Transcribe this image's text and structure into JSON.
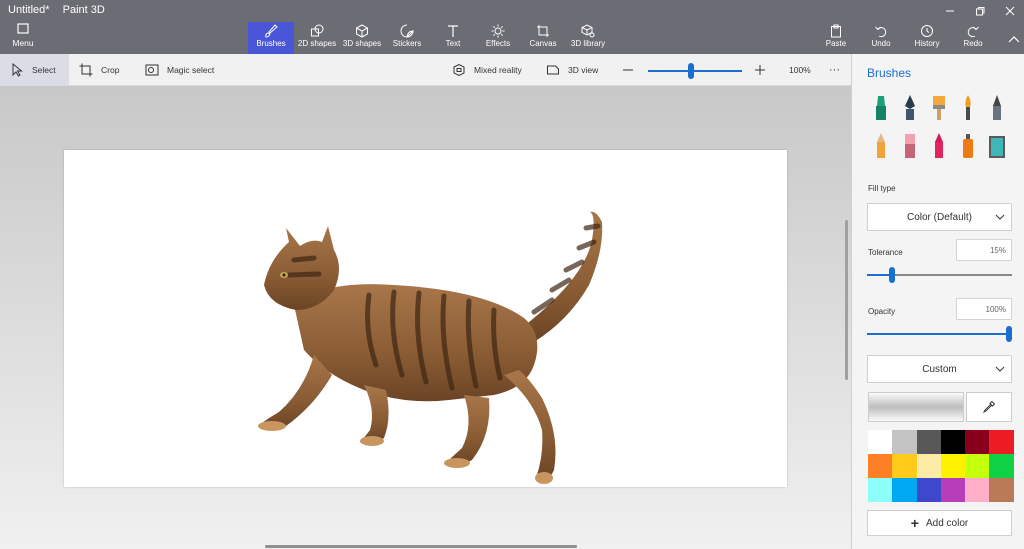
{
  "titlebar": {
    "document": "Untitled*",
    "app": "Paint 3D"
  },
  "menu": {
    "label": "Menu",
    "icon": "menu-icon"
  },
  "tabs": [
    {
      "id": "brushes",
      "label": "Brushes",
      "icon": "brush-icon",
      "active": true
    },
    {
      "id": "2d-shapes",
      "label": "2D shapes",
      "icon": "2d-shapes-icon"
    },
    {
      "id": "3d-shapes",
      "label": "3D shapes",
      "icon": "cube-icon"
    },
    {
      "id": "stickers",
      "label": "Stickers",
      "icon": "sticker-icon"
    },
    {
      "id": "text",
      "label": "Text",
      "icon": "text-icon"
    },
    {
      "id": "effects",
      "label": "Effects",
      "icon": "sun-icon"
    },
    {
      "id": "canvas",
      "label": "Canvas",
      "icon": "canvas-icon"
    },
    {
      "id": "3d-library",
      "label": "3D library",
      "icon": "library-icon"
    }
  ],
  "actions": [
    {
      "id": "paste",
      "label": "Paste",
      "icon": "paste-icon"
    },
    {
      "id": "undo",
      "label": "Undo",
      "icon": "undo-icon"
    },
    {
      "id": "history",
      "label": "History",
      "icon": "history-icon"
    },
    {
      "id": "redo",
      "label": "Redo",
      "icon": "redo-icon"
    }
  ],
  "subtoolbar": {
    "select": "Select",
    "crop": "Crop",
    "magic_select": "Magic select",
    "mixed_reality": "Mixed reality",
    "view_3d": "3D view",
    "zoom_value": "100%",
    "zoom_level": 0.46,
    "more": "···"
  },
  "panel": {
    "title": "Brushes",
    "brushes": [
      "marker",
      "calligraphy-pen",
      "oil-brush",
      "watercolor",
      "pixel-pen",
      "pencil",
      "eraser",
      "crayon",
      "spray-can",
      "fill"
    ],
    "fill_type_label": "Fill type",
    "fill_type_value": "Color (Default)",
    "tolerance_label": "Tolerance",
    "tolerance_value": "15%",
    "tolerance_level": 0.15,
    "opacity_label": "Opacity",
    "opacity_value": "100%",
    "opacity_level": 1.0,
    "color_mode": "Custom",
    "add_color": "Add color",
    "palette": [
      "#ffffff",
      "#c3c3c3",
      "#585858",
      "#000000",
      "#88001b",
      "#ec1c24",
      "#ff7f27",
      "#ffca18",
      "#fdeca6",
      "#fff200",
      "#c4ff0e",
      "#0ed145",
      "#8cfffb",
      "#00a8f3",
      "#3f48cc",
      "#b83dba",
      "#ffaec8",
      "#b97a56"
    ]
  },
  "accent": "#4a56d8"
}
